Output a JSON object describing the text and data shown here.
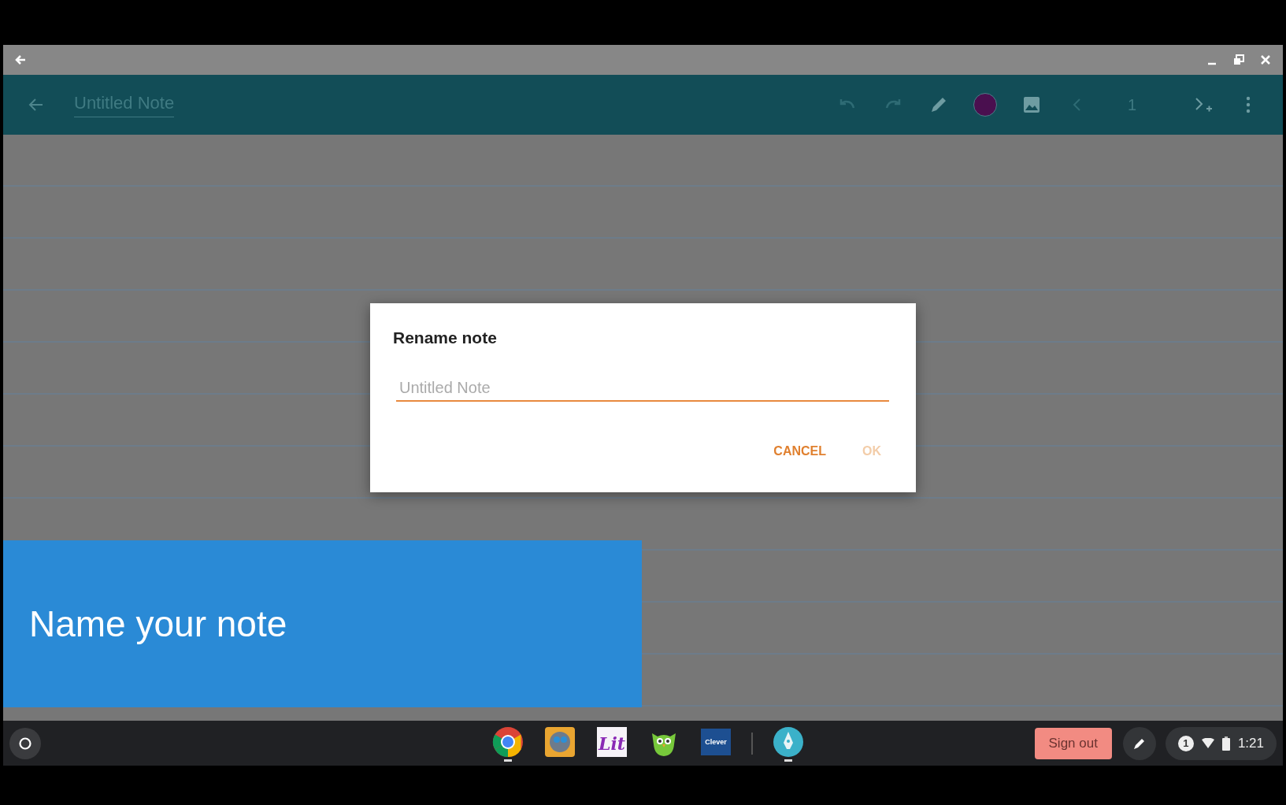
{
  "toolbar": {
    "title": "Untitled Note",
    "undo_disabled": true,
    "redo_disabled": true,
    "page_number": "1"
  },
  "dialog": {
    "title": "Rename note",
    "field": {
      "placeholder": "Untitled Note"
    },
    "buttons": [
      {
        "label": "CANCEL",
        "disabled": false
      },
      {
        "label": "OK",
        "disabled": true
      }
    ]
  },
  "caption": "Name your note",
  "taskbar": {
    "apps": [
      {
        "kind": "chrome",
        "active": true
      },
      {
        "kind": "robot",
        "active": false
      },
      {
        "kind": "lit",
        "text": "Lit",
        "active": false
      },
      {
        "kind": "owl",
        "active": false
      },
      {
        "kind": "clever",
        "text": "Clever",
        "active": false
      },
      {
        "kind": "pen",
        "active": true
      }
    ],
    "sign_out": "Sign out",
    "notifications": "1",
    "time": "1:21"
  }
}
